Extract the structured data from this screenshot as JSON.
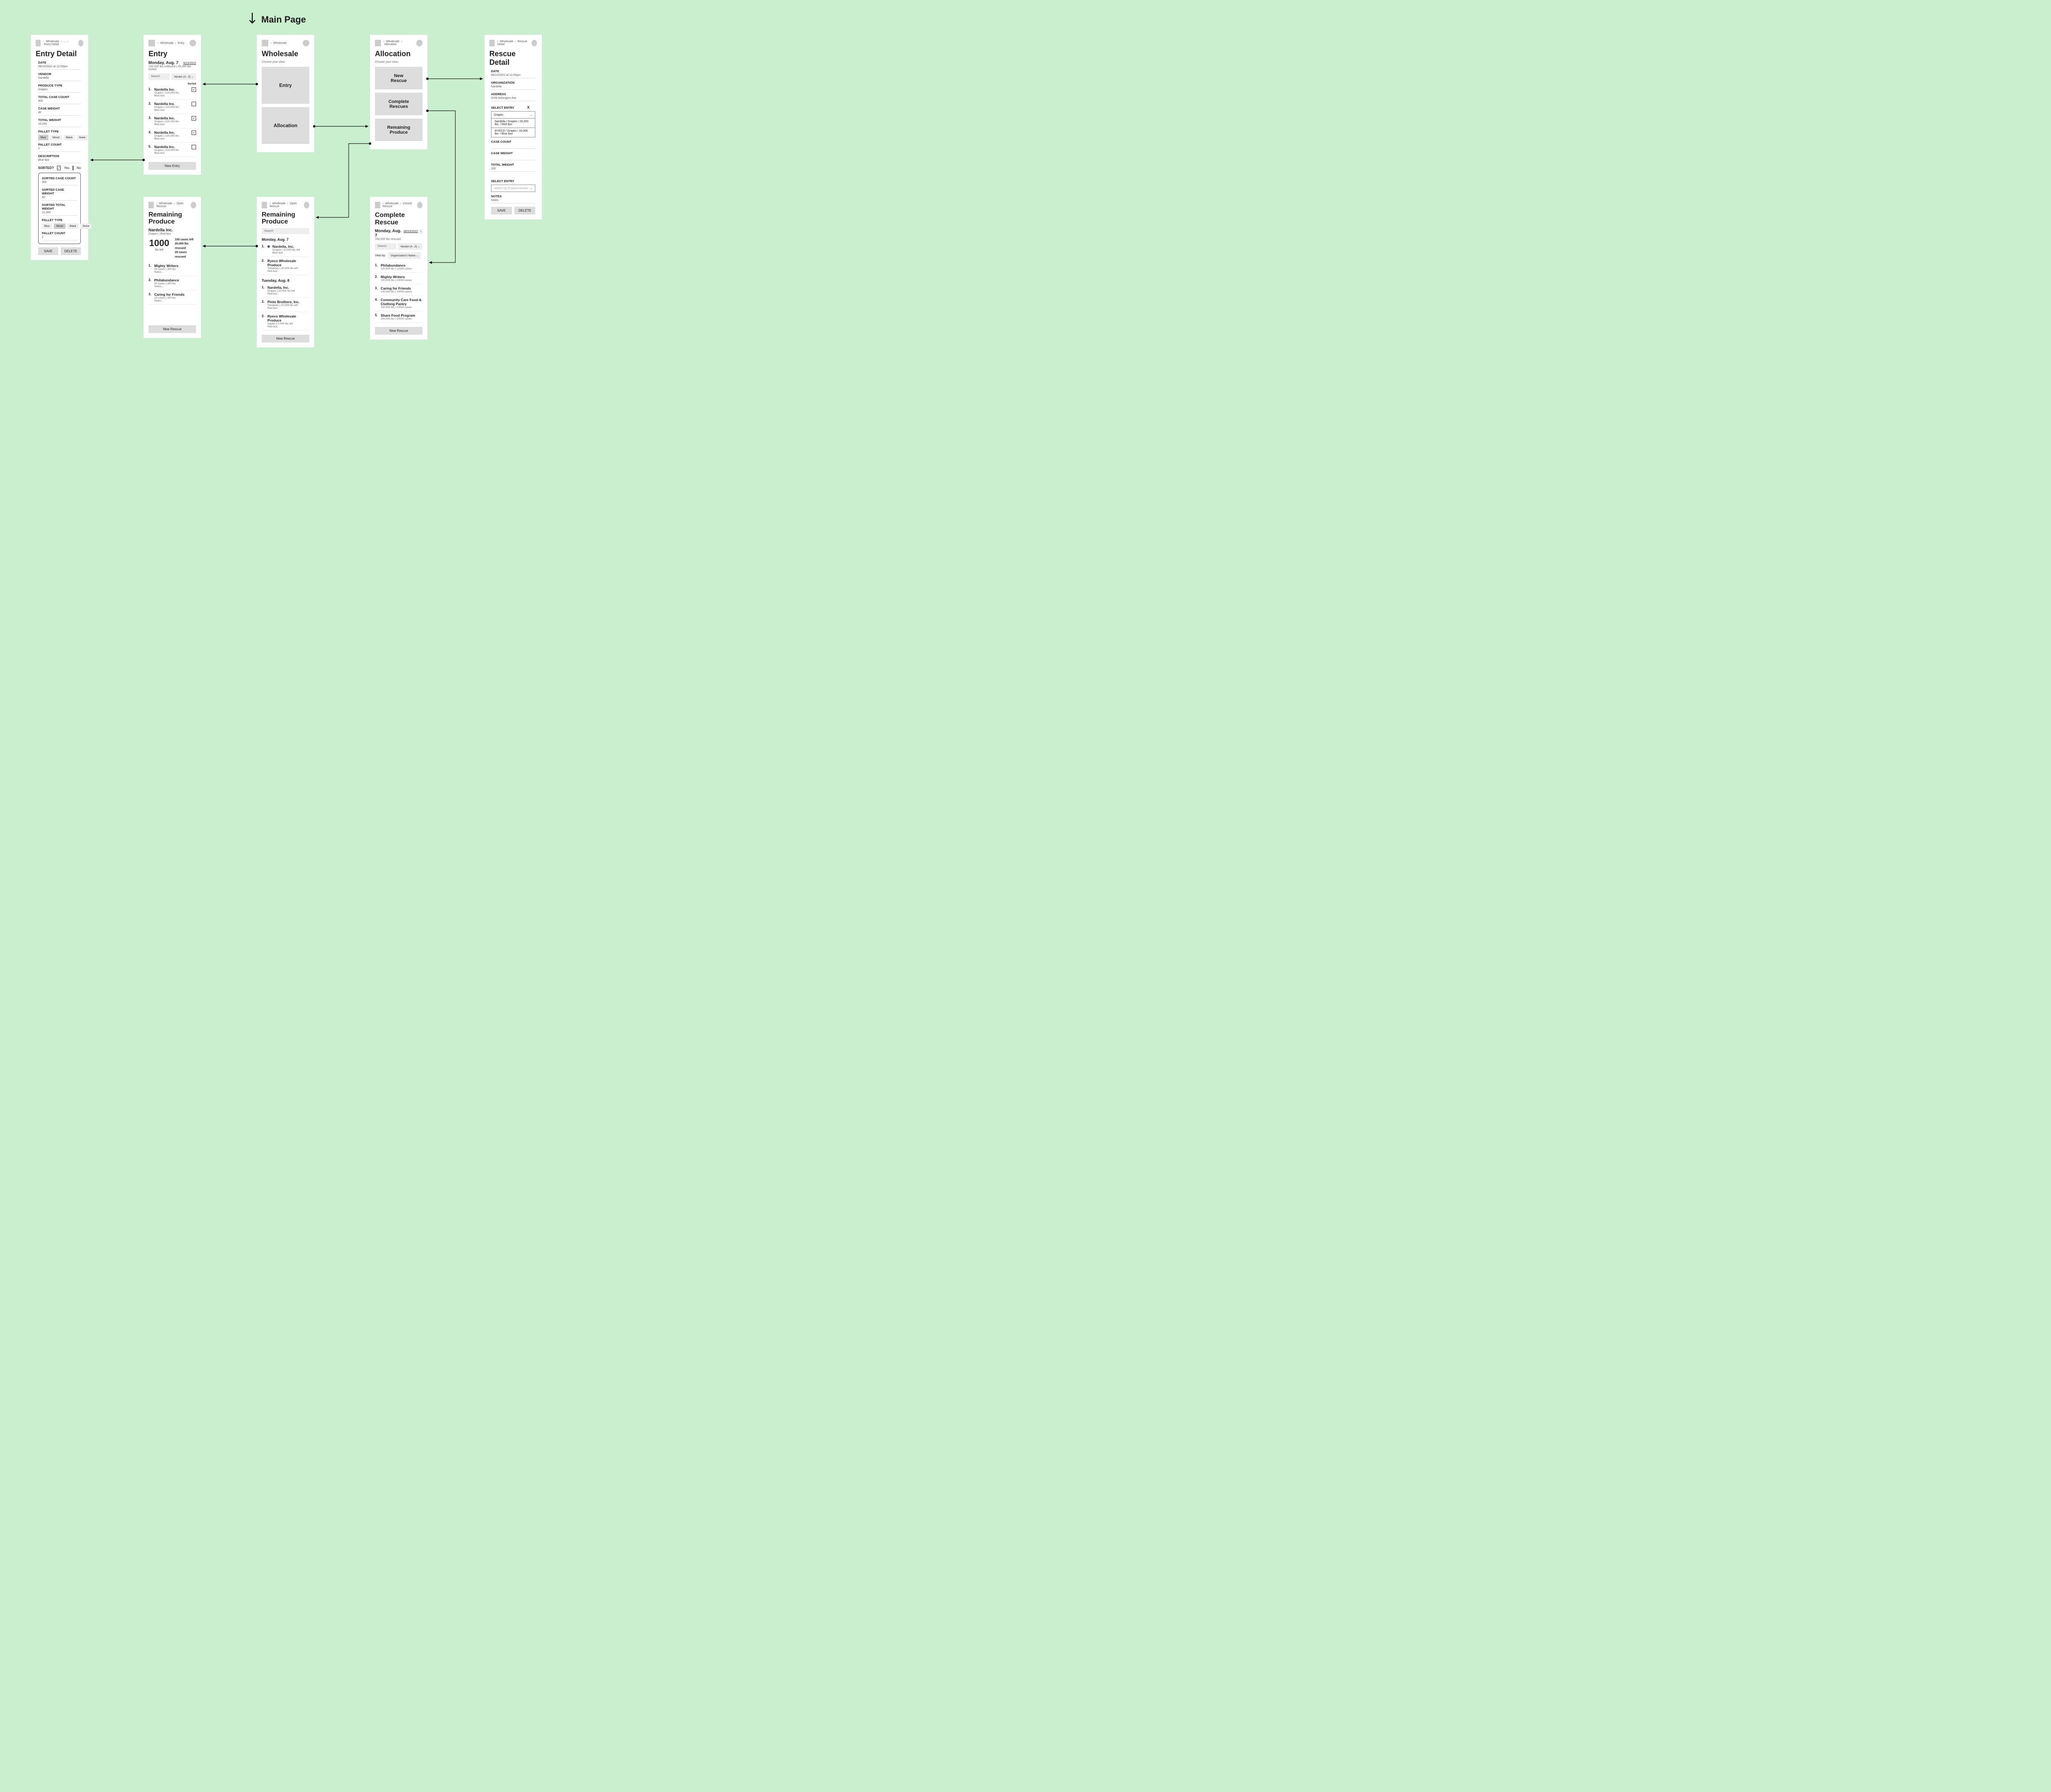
{
  "title": "Main Page",
  "screens": {
    "entry_detail": {
      "crumbs": [
        "Wholesale",
        "...",
        "Entry Detail"
      ],
      "heading": "Entry Detail",
      "fields": {
        "date": {
          "label": "DATE",
          "value": "08/10/2022 at 12:00pm"
        },
        "vendor": {
          "label": "VENDOR",
          "value": "Nardella"
        },
        "produce_type": {
          "label": "PRODUCE TYPE",
          "value": "Grapes"
        },
        "total_case_count": {
          "label": "TOTAL CASE COUNT",
          "value": "400"
        },
        "case_weight": {
          "label": "CASE WEIGHT",
          "value": "40"
        },
        "total_weight": {
          "label": "TOTAL WEIGHT",
          "value": "16,000"
        },
        "pallet_type_label": "PALLET TYPE",
        "pallet_types": [
          "Blue",
          "Wood",
          "Black",
          "None"
        ],
        "pallet_count": {
          "label": "PALLET COUNT",
          "value": "2"
        },
        "description": {
          "label": "DESCRIPTION",
          "value": "Blue box"
        }
      },
      "sorted_q": {
        "label": "SORTED?",
        "yes": "Yes",
        "no": "No"
      },
      "sorted_box": {
        "sorted_case_count": {
          "label": "SORTED CASE COUNT",
          "value": "300"
        },
        "sorted_case_weight": {
          "label": "SORTED CASE WEIGHT",
          "value": "40"
        },
        "sorted_total_weight": {
          "label": "SORTED TOTAL WEIGHT",
          "value": "12,000"
        },
        "pallet_type_label": "PALLET TYPE",
        "pallet_types": [
          "Blue",
          "Wood",
          "Black",
          "None"
        ],
        "pallet_count": {
          "label": "PALLET COUNT",
          "value": "2"
        }
      },
      "save": "SAVE",
      "delete": "DELETE"
    },
    "entry": {
      "crumbs": [
        "Wholesale",
        "Entry"
      ],
      "heading": "Entry",
      "date_heading": "Monday, Aug. 7",
      "date_link": "8/10/2022",
      "summary": "150,000 lbs collected | 45,000 lbs sorted",
      "search": "Search",
      "sort": "Vendor (A - Z)",
      "sorted_label": "Sorted",
      "items": [
        {
          "n": "1.",
          "t": "Nardella Inc.",
          "s": "Grapes | 120,000 lbs",
          "b": "Blue box",
          "chk": true
        },
        {
          "n": "2.",
          "t": "Nardella Inc.",
          "s": "Grapes | 120,000 lbs",
          "b": "Blue box",
          "chk": false
        },
        {
          "n": "3.",
          "t": "Nardella Inc.",
          "s": "Grapes | 120,000 lbs",
          "b": "Blue box",
          "chk": true
        },
        {
          "n": "4.",
          "t": "Nardella Inc.",
          "s": "Grapes | 120,000 lbs",
          "b": "Blue box",
          "chk": true
        },
        {
          "n": "5.",
          "t": "Nardella Inc.",
          "s": "Grapes | 120,000 lbs",
          "b": "Blue box",
          "chk": false
        }
      ],
      "new_entry": "New Entry"
    },
    "wholesale": {
      "crumbs": [
        "Wholesale"
      ],
      "heading": "Wholesale",
      "choose": "Choose your view:",
      "entry": "Entry",
      "allocation": "Allocation"
    },
    "allocation": {
      "crumbs": [
        "Wholesale",
        "Allocation"
      ],
      "heading": "Allocation",
      "choose": "Choose your view:",
      "new_rescue": "New\nRescue",
      "complete": "Complete\nRescues",
      "remaining": "Remaining\nProduce"
    },
    "rescue_detail": {
      "crumbs": [
        "Wholesale",
        "Rescue Detail"
      ],
      "heading": "Rescue Detail",
      "date": {
        "label": "DATE",
        "value": "08/10/2022 at 12:00pm"
      },
      "org": {
        "label": "ORGANIZATION",
        "value": "Nardella"
      },
      "address": {
        "label": "ADDRESS",
        "value": "9700 Ashington Ave"
      },
      "select_entry": "SELECT ENTRY",
      "select_value": "Grapes",
      "options": [
        "Nardella / Grapes / 20,000 lbs. / Red box",
        "RYECO / Grapes / 10,000 lbs. / Blue box"
      ],
      "case_count": "CASE COUNT",
      "case_weight": "CASE WEIGHT",
      "total_weight": {
        "label": "TOTAL WEIGHT",
        "value": "200"
      },
      "select_entry2": "SELECT ENTRY",
      "placeholder2": "Search by Produce/Vendor",
      "notes": {
        "label": "NOTES",
        "value": "Notes"
      },
      "save": "SAVE",
      "delete": "DELETE"
    },
    "remaining_left": {
      "crumbs": [
        "Wholesale",
        "Open Rescue"
      ],
      "heading": "Remaining Produce",
      "vendor": "Nardella Inc.",
      "vendor_sub": "Grapes | Red box",
      "big_num": "1000",
      "big_sub": "lbs left",
      "lines": [
        "100 cases left",
        "20,000 lbs rescued",
        "20 cases rescued"
      ],
      "items": [
        {
          "n": "1.",
          "t": "Mighty Writers",
          "s": "50 cases | 300 lbs",
          "b": "Notes..."
        },
        {
          "n": "2.",
          "t": "Philabundance",
          "s": "30 cases | 300 lbs",
          "b": "Notes..."
        },
        {
          "n": "3.",
          "t": "Caring for Friends",
          "s": "10 cases | 100 lbs",
          "b": "Notes..."
        }
      ],
      "new_rescue": "New Rescue"
    },
    "remaining_center": {
      "crumbs": [
        "Wholesale",
        "Open Rescue"
      ],
      "heading": "Remaining Produce",
      "search": "Search",
      "day1": "Monday, Aug. 7",
      "day1_items": [
        {
          "n": "1.",
          "t": "Nardella, Inc.",
          "s": "Grapes | 20,000 lbs left",
          "b": "Blue box",
          "dot": true
        },
        {
          "n": "2.",
          "t": "Ryeco Wholesale Produce",
          "s": "Tomatoes | 20,000 lbs left",
          "b": "Red box"
        }
      ],
      "day2": "Tuesday, Aug. 8",
      "day2_items": [
        {
          "n": "1.",
          "t": "Nardella, Inc.",
          "s": "Grapes | 20,000 lbs left",
          "b": "Red box"
        },
        {
          "n": "2.",
          "t": "Pinto Brothers, Inc.",
          "s": "Tomatoes | 20,000 lbs left",
          "b": "Red box"
        },
        {
          "n": "2.",
          "t": "Ryeco Wholesale Produce",
          "s": "Apples | 5,000 lbs left",
          "b": "Red box"
        }
      ],
      "new_rescue": "New Rescue"
    },
    "complete_rescue": {
      "crumbs": [
        "Wholesale",
        "Closed Rescue"
      ],
      "heading": "Complete Rescue",
      "date_heading": "Monday, Aug. 7",
      "date_link": "08/10/2022",
      "summary": "150,000 lbs rescued",
      "search": "Search",
      "sort": "Vendor (A - Z)",
      "viewby_label": "View by:",
      "viewby": "Organization's Name",
      "items": [
        {
          "n": "1.",
          "t": "Philabundance",
          "s": "120,000 lbs | 12000 cases"
        },
        {
          "n": "2.",
          "t": "Mighty Writers",
          "s": "100,000 lbs | 10000 cases"
        },
        {
          "n": "3.",
          "t": "Caring for Friends",
          "s": "100,000 lbs | 10000 cases"
        },
        {
          "n": "4.",
          "t": "Community Care Food & Clothing Pantry",
          "s": "100,000 lbs | 10000 cases"
        },
        {
          "n": "5.",
          "t": "Share Food Program",
          "s": "100,000 lbs | 10000 cases"
        }
      ],
      "new_rescue": "New Rescue"
    }
  }
}
